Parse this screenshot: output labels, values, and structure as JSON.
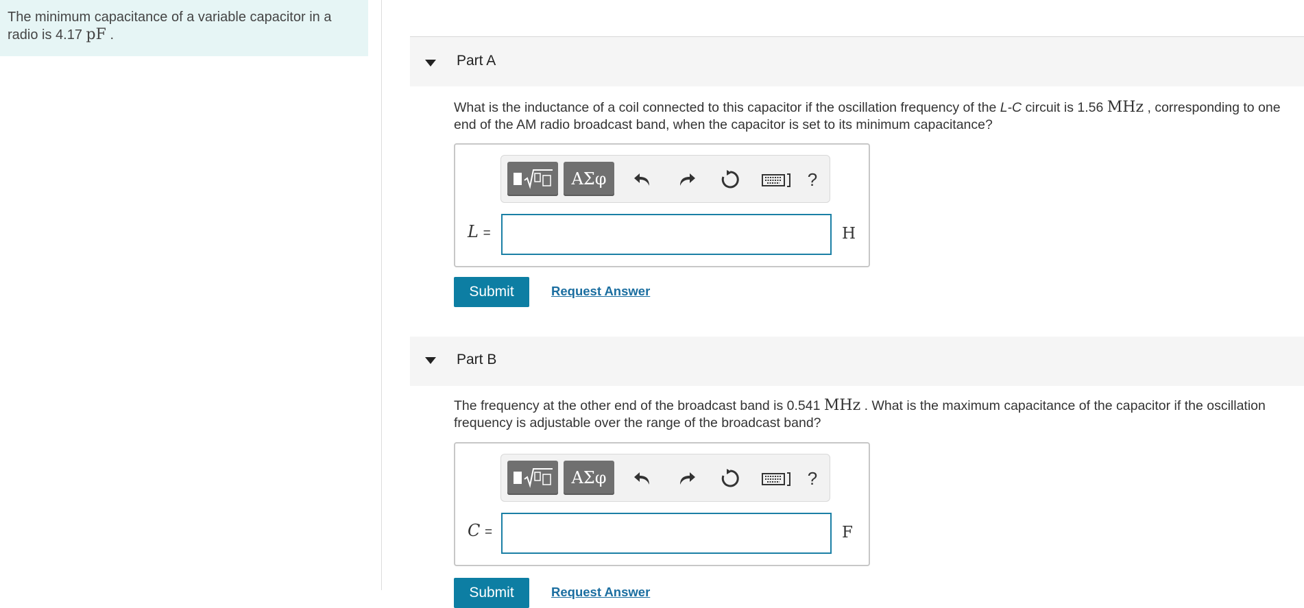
{
  "problem": {
    "text": "The minimum capacitance of a variable capacitor in a radio is 4.17",
    "unit": "pF",
    "suffix": "."
  },
  "partA": {
    "title": "Part A",
    "question_pre": "What is the inductance of a coil connected to this capacitor if the oscillation frequency of the ",
    "question_italic": "L-C",
    "question_mid": " circuit is 1.56 ",
    "question_unit": "MHz",
    "question_post": " , corresponding to one end of the AM radio broadcast band, when the capacitor is set to its minimum capacitance?",
    "toolbar": {
      "greek_label": "ΑΣφ",
      "help_label": "?"
    },
    "variable": "L",
    "equals": "=",
    "input_value": "",
    "unit": "H",
    "submit_label": "Submit",
    "request_label": "Request Answer"
  },
  "partB": {
    "title": "Part B",
    "question_pre": "The frequency at the other end of the broadcast band is 0.541 ",
    "question_unit": "MHz",
    "question_post": " . What is the maximum capacitance of the capacitor if the oscillation frequency is adjustable over the range of the broadcast band?",
    "toolbar": {
      "greek_label": "ΑΣφ",
      "help_label": "?"
    },
    "variable": "C",
    "equals": "=",
    "input_value": "",
    "unit": "F",
    "submit_label": "Submit",
    "request_label": "Request Answer"
  },
  "colors": {
    "problem_bg": "#e6f5f5",
    "accent": "#0d7ea3",
    "link": "#1b6ea0",
    "input_border": "#1a7fa5"
  }
}
